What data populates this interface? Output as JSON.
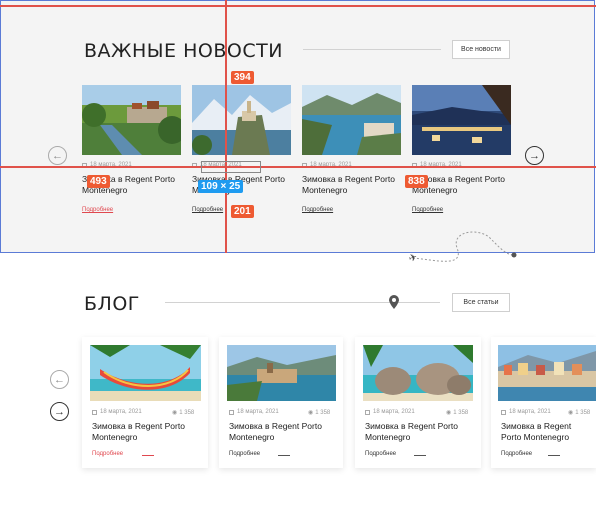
{
  "news": {
    "title": "ВАЖНЫЕ НОВОСТИ",
    "all_button": "Все новости",
    "cards": [
      {
        "date": "18 марта, 2021",
        "title": "Зимовка в Regent Porto Montenegro",
        "more": "Подробнее",
        "photo": "river-town"
      },
      {
        "date": "18 марта, 2021",
        "title": "Зимовка в Regent Porto Montenegro",
        "more": "Подробнее",
        "photo": "lake-church"
      },
      {
        "date": "18 марта, 2021",
        "title": "Зимовка в Regent Porto Montenegro",
        "more": "Подробнее",
        "photo": "bay-coast"
      },
      {
        "date": "18 марта, 2021",
        "title": "Зимовка в Regent Porto Montenegro",
        "more": "Подробнее",
        "photo": "night-terrace"
      }
    ]
  },
  "measure": {
    "top": "394",
    "left": "493",
    "right": "838",
    "bottom": "201",
    "size": "109 × 25"
  },
  "blog": {
    "title": "БЛОГ",
    "all_button": "Все статьи",
    "cards": [
      {
        "date": "18 марта, 2021",
        "views": "1 358",
        "title": "Зимовка в Regent Porto Montenegro",
        "more": "Подробнее",
        "photo": "hammock"
      },
      {
        "date": "18 марта, 2021",
        "views": "1 358",
        "title": "Зимовка в Regent Porto Montenegro",
        "more": "Подробнее",
        "photo": "coast-town"
      },
      {
        "date": "18 марта, 2021",
        "views": "1 358",
        "title": "Зимовка в Regent Porto Montenegro",
        "more": "Подробнее",
        "photo": "rocks-beach"
      },
      {
        "date": "18 марта, 2021",
        "views": "1 358",
        "title": "Зимовка в Regent Porto Montenegro",
        "more": "Подробнее",
        "photo": "harbor"
      }
    ]
  },
  "icons": [
    "calendar-icon",
    "eye-icon",
    "arrow-left-icon",
    "arrow-right-icon",
    "airplane-icon",
    "location-pin-icon"
  ],
  "colors": {
    "accent": "#e0484f",
    "guide": "#e0524a",
    "tag_orange": "#ee5a32",
    "tag_blue": "#1e9bf0",
    "section_border": "#5b7bd6"
  }
}
